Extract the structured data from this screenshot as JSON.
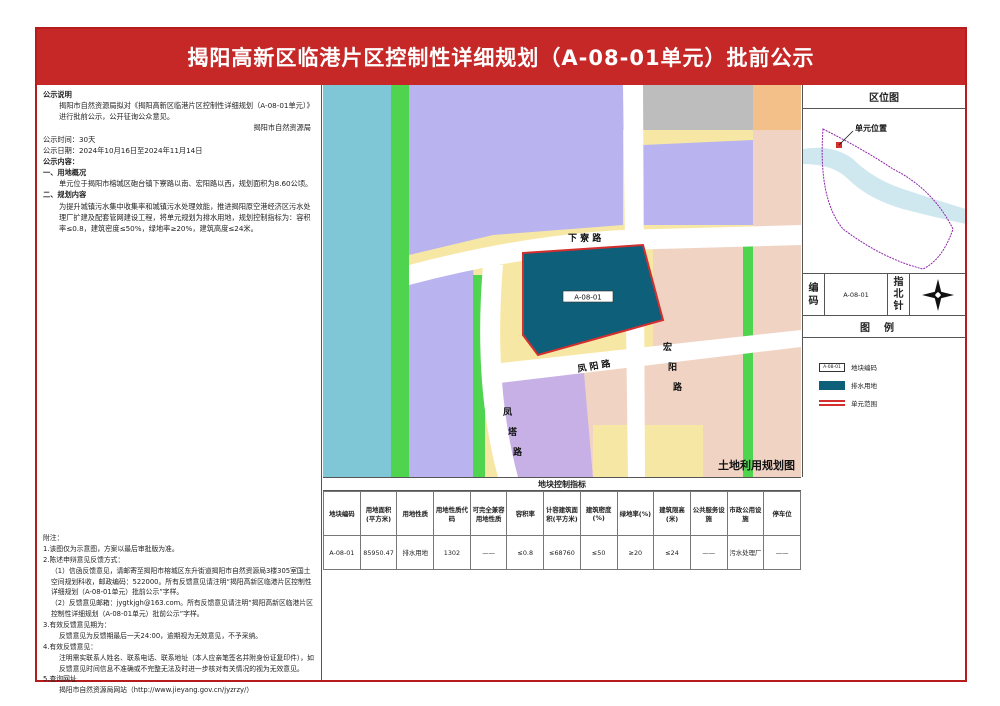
{
  "title": "揭阳高新区临港片区控制性详细规划（A-08-01单元）批前公示",
  "notice": {
    "heading": "公示说明",
    "body": "揭阳市自然资源局拟对《揭阳高新区临港片区控制性详细规划（A-08-01单元）》进行批前公示，公开征询公众意见。",
    "signature": "揭阳市自然资源局",
    "period": "公示时间：30天",
    "dates": "公示日期：2024年10月16日至2024年11月14日",
    "content_heading": "公示内容：",
    "sec1_title": "一、用地概况",
    "sec1_body": "单元位于揭阳市榕城区砲台镇下寮路以南、宏阳路以西，规划面积为8.60公顷。",
    "sec2_title": "二、规划内容",
    "sec2_body": "为提升城镇污水集中收集率和城镇污水处理效能，推进揭阳原空港经济区污水处理厂扩建及配套管网建设工程，将单元规划为排水用地，规划控制指标为：容积率≤0.8，建筑密度≤50%，绿地率≥20%，建筑高度≤24米。"
  },
  "notes": {
    "heading": "附注：",
    "n1": "1.该图仅为示意图，方案以最后审批版为准。",
    "n2": "2.陈述申辩意见反馈方式：",
    "n2a": "（1）信函反馈意见，请邮寄至揭阳市榕城区东升街道揭阳市自然资源局3楼305室国土空间规划科收，邮政编码：522000。所有反馈意见请注明“揭阳高新区临港片区控制性详细规划（A-08-01单元）批前公示”字样。",
    "n2b": "（2）反馈意见邮箱：jygtkjgh@163.com。所有反馈意见请注明“揭阳高新区临港片区控制性详细规划（A-08-01单元）批前公示”字样。",
    "n3": "3.有效反馈意见期为：",
    "n3a": "反馈意见为反馈期最后一天24:00，逾期视为无效意见，不予采纳。",
    "n4": "4.有效反馈意见：",
    "n4a": "注明需实联系人姓名、联系电话、联系地址（本人应亲笔签名并附身份证复印件），如反馈意见时间信息不准确或不完整无法及时进一步核对有关情况的视为无效意见。",
    "n5": "5.查询网址",
    "n5a": "揭阳市自然资源局网站（http://www.jieyang.gov.cn/jyzrzy/）"
  },
  "map": {
    "label": "土地利用规划图",
    "parcel_label": "A-08-01",
    "road_xialiao": "下 寮 路",
    "road_fengyang": "凤 阳 路",
    "road_hongyang_1": "宏",
    "road_hongyang_2": "阳",
    "road_hongyang_3": "路",
    "road_fengta_1": "凤",
    "road_fengta_2": "塔",
    "road_fengta_3": "路"
  },
  "location": {
    "heading": "区位图",
    "marker_label": "单元位置"
  },
  "code_box": {
    "label_1": "编",
    "label_2": "码",
    "value": "A-08-01",
    "north_1": "指",
    "north_2": "北",
    "north_3": "针"
  },
  "legend": {
    "heading": "图例",
    "items": [
      {
        "swatch_text": "A-08-01",
        "label": "地块编码"
      },
      {
        "swatch_text": "",
        "label": "排水用地"
      },
      {
        "swatch_text": "",
        "label": "单元范围"
      }
    ]
  },
  "table": {
    "title": "地块控制指标",
    "headers": [
      "地块编码",
      "用地面积(平方米)",
      "用地性质",
      "用地性质代码",
      "可完全兼容用地性质",
      "容积率",
      "计容建筑面积(平方米)",
      "建筑密度(%)",
      "绿地率(%)",
      "建筑限高(米)",
      "公共服务设施",
      "市政公用设施",
      "停车位"
    ],
    "row": [
      "A-08-01",
      "85950.47",
      "排水用地",
      "1302",
      "——",
      "≤0.8",
      "≤68760",
      "≤50",
      "≥20",
      "≤24",
      "——",
      "污水处理厂",
      "——"
    ]
  },
  "colors": {
    "title_bar": "#c62828",
    "drainage": "#0d5f7a",
    "residential": "#b9b3ef",
    "commercial": "#f1d3c4",
    "industrial": "#e8cfc0",
    "green": "#4fd44f",
    "water": "#7fc6d6",
    "yellow": "#f7e7a4",
    "boundary": "#d32f2f"
  }
}
